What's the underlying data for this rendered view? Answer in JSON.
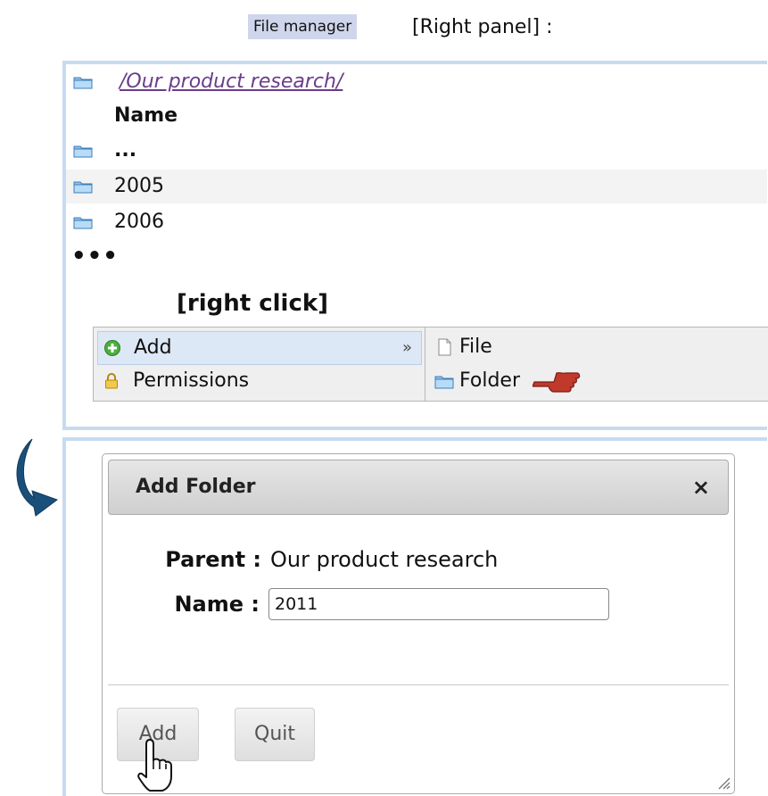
{
  "header": {
    "tag": "File manager",
    "subtitle": "[Right panel] :"
  },
  "panel": {
    "path": "/Our product research/",
    "column_header": "Name",
    "rows": [
      {
        "label": "..."
      },
      {
        "label": "2005"
      },
      {
        "label": "2006"
      }
    ],
    "more": "•••",
    "action_hint": "[right click]"
  },
  "context_menu": {
    "items": [
      {
        "label": "Add",
        "arrow": "»",
        "icon": "add-icon",
        "highlighted": true
      },
      {
        "label": "Permissions",
        "icon": "lock-icon",
        "highlighted": false
      }
    ],
    "submenu": [
      {
        "label": "File",
        "icon": "file-icon"
      },
      {
        "label": "Folder",
        "icon": "folder-icon"
      }
    ]
  },
  "dialog": {
    "title": "Add Folder",
    "close": "×",
    "parent_label": "Parent :",
    "parent_value": "Our product research",
    "name_label": "Name :",
    "name_value": "2011",
    "add_button": "Add",
    "quit_button": "Quit"
  },
  "colors": {
    "panel_border": "#c7daf0",
    "tag_bg": "#cfd6ec",
    "link": "#6a3d8a",
    "arrow": "#1a4f7a",
    "pointer_hand": "#b03a2e"
  }
}
